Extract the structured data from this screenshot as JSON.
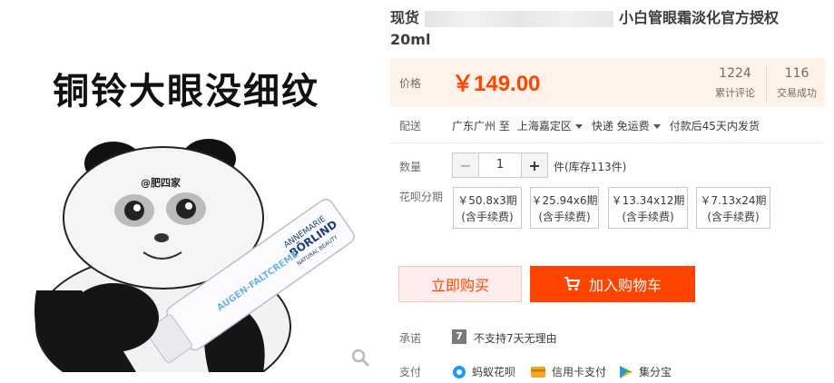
{
  "gallery": {
    "caption": "铜铃大眼没细纹",
    "watermark": "@肥四家",
    "tube_brand_line1": "ANNEMARIE",
    "tube_brand_line2": "BÖRLIND",
    "tube_sub": "NATURAL BEAUTY",
    "tube_product": "AUGEN-FALTCREME"
  },
  "product": {
    "title_prefix": "现货",
    "title_suffix": "小白管眼霜淡化官方授权",
    "title_line2": "20ml"
  },
  "price": {
    "label": "价格",
    "value": "￥149.00",
    "reviews_count": "1224",
    "reviews_label": "累计评论",
    "sales_count": "116",
    "sales_label": "交易成功"
  },
  "shipping": {
    "label": "配送",
    "origin": "广东广州 至",
    "destination": "上海嘉定区",
    "method": "快递 免运费",
    "eta": "付款后45天内发货"
  },
  "quantity": {
    "label": "数量",
    "value": "1",
    "minus": "−",
    "plus": "+",
    "stock": "件(库存113件)"
  },
  "installments": {
    "label": "花呗分期",
    "options": [
      {
        "line1": "￥50.8x3期",
        "line2": "(含手续费)"
      },
      {
        "line1": "￥25.94x6期",
        "line2": "(含手续费)"
      },
      {
        "line1": "￥13.34x12期",
        "line2": "(含手续费)"
      },
      {
        "line1": "￥7.13x24期",
        "line2": "(含手续费)"
      }
    ]
  },
  "actions": {
    "buy_now": "立即购买",
    "add_to_cart": "加入购物车"
  },
  "promise": {
    "label": "承诺",
    "icon_glyph": "7",
    "text": "不支持7天无理由"
  },
  "payment": {
    "label": "支付",
    "methods": [
      {
        "name": "蚂蚁花呗",
        "icon": "huabei-icon",
        "color": "#1e9bf0"
      },
      {
        "name": "信用卡支付",
        "icon": "credit-card-icon",
        "color": "#f5a623"
      },
      {
        "name": "集分宝",
        "icon": "jifenbao-icon",
        "color": "#4caf50"
      }
    ]
  },
  "colors": {
    "accent": "#ff4400",
    "price_bg": "#fff2e8"
  }
}
